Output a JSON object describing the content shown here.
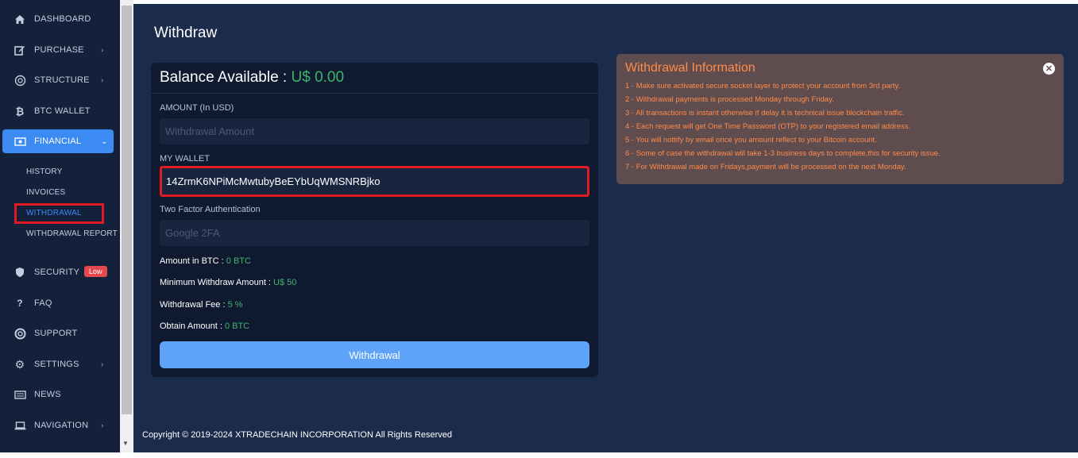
{
  "sidebar": {
    "items": [
      {
        "label": "DASHBOARD",
        "icon": "home-icon"
      },
      {
        "label": "PURCHASE",
        "icon": "edit-icon"
      },
      {
        "label": "STRUCTURE",
        "icon": "structure-icon"
      },
      {
        "label": "BTC WALLET",
        "icon": "bitcoin-icon"
      },
      {
        "label": "FINANCIAL",
        "icon": "money-icon"
      },
      {
        "label": "SECURITY",
        "icon": "shield-icon",
        "badge": "Low"
      },
      {
        "label": "FAQ",
        "icon": "question-icon"
      },
      {
        "label": "SUPPORT",
        "icon": "lifebuoy-icon"
      },
      {
        "label": "SETTINGS",
        "icon": "gear-icon"
      },
      {
        "label": "NEWS",
        "icon": "newspaper-icon"
      },
      {
        "label": "NAVIGATION",
        "icon": "laptop-icon"
      }
    ],
    "financial_sub": [
      "HISTORY",
      "INVOICES",
      "WITHDRAWAL",
      "WITHDRAWAL REPORT"
    ]
  },
  "page": {
    "title": "Withdraw"
  },
  "form": {
    "balance_label": "Balance Available :",
    "balance_value": "U$ 0.00",
    "amount_label": "AMOUNT (In USD)",
    "amount_placeholder": "Withdrawal Amount",
    "wallet_label": "MY WALLET",
    "wallet_value": "14ZrmK6NPiMcMwtubyBeEYbUqWMSNRBjko",
    "twofa_label": "Two Factor Authentication",
    "twofa_placeholder": "Google 2FA",
    "amount_btc_label": "Amount in BTC :",
    "amount_btc_value": "0 BTC",
    "min_label": "Minimum Withdraw Amount :",
    "min_value": "U$ 50",
    "fee_label": "Withdrawal Fee :",
    "fee_value": "5 %",
    "obtain_label": "Obtain Amount :",
    "obtain_value": "0 BTC",
    "button_label": "Withdrawal"
  },
  "info": {
    "title": "Withdrawal Information",
    "items": [
      "1 -  Make sure activated secure socket layer to protect your account from 3rd party.",
      "2 -  Withdrawal payments is processed Monday through Friday.",
      "3 -  All transactions is instant otherwise if delay it is technical issue blockchain traffic.",
      "4 -  Each request will get One Time Password (OTP) to your registered email address.",
      "5 -  You will nottify by email once you amount reflect to your Bitcoin account.",
      "6 -  Some of case the withdrawal will take 1-3 business days to complete,this for security issue.",
      "7 -  For Withdrawal made on Fridays,payment will be processed on the next Monday."
    ]
  },
  "footer": {
    "copyright": "Copyright © 2019-2024 XTRADECHAIN INCORPORATION All Rights Reserved"
  },
  "colors": {
    "accent": "#3b8bf2",
    "success": "#3fb56a",
    "warning_text": "#ff8c4a",
    "danger": "#e01b24"
  }
}
